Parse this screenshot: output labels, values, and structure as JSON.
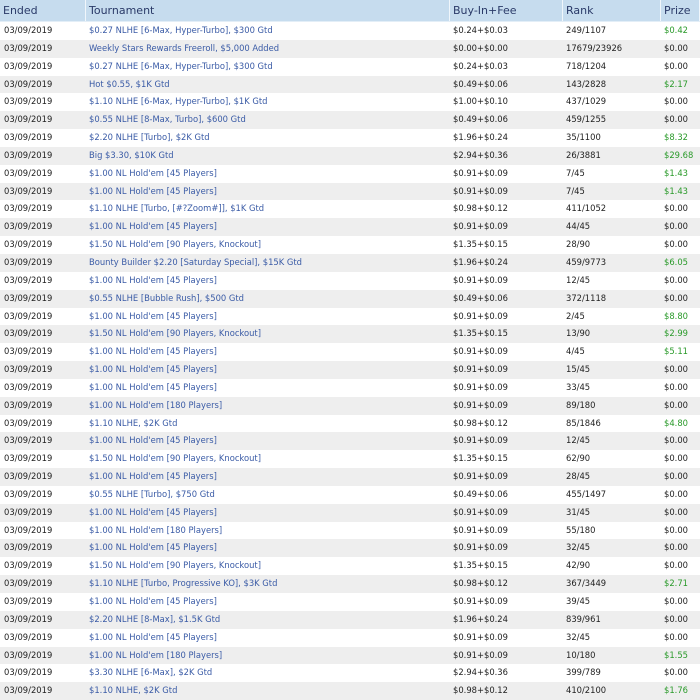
{
  "headers": {
    "ended": "Ended",
    "tournament": "Tournament",
    "buyin": "Buy-In+Fee",
    "rank": "Rank",
    "prize": "Prize"
  },
  "rows": [
    {
      "ended": "03/09/2019",
      "tournament": "$0.27 NLHE [6-Max, Hyper-Turbo], $300 Gtd",
      "buyin": "$0.24+$0.03",
      "rank": "249/1107",
      "prize": "$0.42"
    },
    {
      "ended": "03/09/2019",
      "tournament": "Weekly Stars Rewards Freeroll, $5,000 Added",
      "buyin": "$0.00+$0.00",
      "rank": "17679/23926",
      "prize": "$0.00"
    },
    {
      "ended": "03/09/2019",
      "tournament": "$0.27 NLHE [6-Max, Hyper-Turbo], $300 Gtd",
      "buyin": "$0.24+$0.03",
      "rank": "718/1204",
      "prize": "$0.00"
    },
    {
      "ended": "03/09/2019",
      "tournament": "Hot $0.55, $1K Gtd",
      "buyin": "$0.49+$0.06",
      "rank": "143/2828",
      "prize": "$2.17"
    },
    {
      "ended": "03/09/2019",
      "tournament": "$1.10 NLHE [6-Max, Hyper-Turbo], $1K Gtd",
      "buyin": "$1.00+$0.10",
      "rank": "437/1029",
      "prize": "$0.00"
    },
    {
      "ended": "03/09/2019",
      "tournament": "$0.55 NLHE [8-Max, Turbo], $600 Gtd",
      "buyin": "$0.49+$0.06",
      "rank": "459/1255",
      "prize": "$0.00"
    },
    {
      "ended": "03/09/2019",
      "tournament": "$2.20 NLHE [Turbo], $2K Gtd",
      "buyin": "$1.96+$0.24",
      "rank": "35/1100",
      "prize": "$8.32"
    },
    {
      "ended": "03/09/2019",
      "tournament": "Big $3.30, $10K Gtd",
      "buyin": "$2.94+$0.36",
      "rank": "26/3881",
      "prize": "$29.68"
    },
    {
      "ended": "03/09/2019",
      "tournament": "$1.00 NL Hold'em [45 Players]",
      "buyin": "$0.91+$0.09",
      "rank": "7/45",
      "prize": "$1.43"
    },
    {
      "ended": "03/09/2019",
      "tournament": "$1.00 NL Hold'em [45 Players]",
      "buyin": "$0.91+$0.09",
      "rank": "7/45",
      "prize": "$1.43"
    },
    {
      "ended": "03/09/2019",
      "tournament": "$1.10 NLHE [Turbo, [#?Zoom#]], $1K Gtd",
      "buyin": "$0.98+$0.12",
      "rank": "411/1052",
      "prize": "$0.00"
    },
    {
      "ended": "03/09/2019",
      "tournament": "$1.00 NL Hold'em [45 Players]",
      "buyin": "$0.91+$0.09",
      "rank": "44/45",
      "prize": "$0.00"
    },
    {
      "ended": "03/09/2019",
      "tournament": "$1.50 NL Hold'em [90 Players, Knockout]",
      "buyin": "$1.35+$0.15",
      "rank": "28/90",
      "prize": "$0.00"
    },
    {
      "ended": "03/09/2019",
      "tournament": "Bounty Builder $2.20 [Saturday Special], $15K Gtd",
      "buyin": "$1.96+$0.24",
      "rank": "459/9773",
      "prize": "$6.05"
    },
    {
      "ended": "03/09/2019",
      "tournament": "$1.00 NL Hold'em [45 Players]",
      "buyin": "$0.91+$0.09",
      "rank": "12/45",
      "prize": "$0.00"
    },
    {
      "ended": "03/09/2019",
      "tournament": "$0.55 NLHE [Bubble Rush], $500 Gtd",
      "buyin": "$0.49+$0.06",
      "rank": "372/1118",
      "prize": "$0.00"
    },
    {
      "ended": "03/09/2019",
      "tournament": "$1.00 NL Hold'em [45 Players]",
      "buyin": "$0.91+$0.09",
      "rank": "2/45",
      "prize": "$8.80"
    },
    {
      "ended": "03/09/2019",
      "tournament": "$1.50 NL Hold'em [90 Players, Knockout]",
      "buyin": "$1.35+$0.15",
      "rank": "13/90",
      "prize": "$2.99"
    },
    {
      "ended": "03/09/2019",
      "tournament": "$1.00 NL Hold'em [45 Players]",
      "buyin": "$0.91+$0.09",
      "rank": "4/45",
      "prize": "$5.11"
    },
    {
      "ended": "03/09/2019",
      "tournament": "$1.00 NL Hold'em [45 Players]",
      "buyin": "$0.91+$0.09",
      "rank": "15/45",
      "prize": "$0.00"
    },
    {
      "ended": "03/09/2019",
      "tournament": "$1.00 NL Hold'em [45 Players]",
      "buyin": "$0.91+$0.09",
      "rank": "33/45",
      "prize": "$0.00"
    },
    {
      "ended": "03/09/2019",
      "tournament": "$1.00 NL Hold'em [180 Players]",
      "buyin": "$0.91+$0.09",
      "rank": "89/180",
      "prize": "$0.00"
    },
    {
      "ended": "03/09/2019",
      "tournament": "$1.10 NLHE, $2K Gtd",
      "buyin": "$0.98+$0.12",
      "rank": "85/1846",
      "prize": "$4.80"
    },
    {
      "ended": "03/09/2019",
      "tournament": "$1.00 NL Hold'em [45 Players]",
      "buyin": "$0.91+$0.09",
      "rank": "12/45",
      "prize": "$0.00"
    },
    {
      "ended": "03/09/2019",
      "tournament": "$1.50 NL Hold'em [90 Players, Knockout]",
      "buyin": "$1.35+$0.15",
      "rank": "62/90",
      "prize": "$0.00"
    },
    {
      "ended": "03/09/2019",
      "tournament": "$1.00 NL Hold'em [45 Players]",
      "buyin": "$0.91+$0.09",
      "rank": "28/45",
      "prize": "$0.00"
    },
    {
      "ended": "03/09/2019",
      "tournament": "$0.55 NLHE [Turbo], $750 Gtd",
      "buyin": "$0.49+$0.06",
      "rank": "455/1497",
      "prize": "$0.00"
    },
    {
      "ended": "03/09/2019",
      "tournament": "$1.00 NL Hold'em [45 Players]",
      "buyin": "$0.91+$0.09",
      "rank": "31/45",
      "prize": "$0.00"
    },
    {
      "ended": "03/09/2019",
      "tournament": "$1.00 NL Hold'em [180 Players]",
      "buyin": "$0.91+$0.09",
      "rank": "55/180",
      "prize": "$0.00"
    },
    {
      "ended": "03/09/2019",
      "tournament": "$1.00 NL Hold'em [45 Players]",
      "buyin": "$0.91+$0.09",
      "rank": "32/45",
      "prize": "$0.00"
    },
    {
      "ended": "03/09/2019",
      "tournament": "$1.50 NL Hold'em [90 Players, Knockout]",
      "buyin": "$1.35+$0.15",
      "rank": "42/90",
      "prize": "$0.00"
    },
    {
      "ended": "03/09/2019",
      "tournament": "$1.10 NLHE [Turbo, Progressive KO], $3K Gtd",
      "buyin": "$0.98+$0.12",
      "rank": "367/3449",
      "prize": "$2.71"
    },
    {
      "ended": "03/09/2019",
      "tournament": "$1.00 NL Hold'em [45 Players]",
      "buyin": "$0.91+$0.09",
      "rank": "39/45",
      "prize": "$0.00"
    },
    {
      "ended": "03/09/2019",
      "tournament": "$2.20 NLHE [8-Max], $1.5K Gtd",
      "buyin": "$1.96+$0.24",
      "rank": "839/961",
      "prize": "$0.00"
    },
    {
      "ended": "03/09/2019",
      "tournament": "$1.00 NL Hold'em [45 Players]",
      "buyin": "$0.91+$0.09",
      "rank": "32/45",
      "prize": "$0.00"
    },
    {
      "ended": "03/09/2019",
      "tournament": "$1.00 NL Hold'em [180 Players]",
      "buyin": "$0.91+$0.09",
      "rank": "10/180",
      "prize": "$1.55"
    },
    {
      "ended": "03/09/2019",
      "tournament": "$3.30 NLHE [6-Max], $2K Gtd",
      "buyin": "$2.94+$0.36",
      "rank": "399/789",
      "prize": "$0.00"
    },
    {
      "ended": "03/09/2019",
      "tournament": "$1.10 NLHE, $2K Gtd",
      "buyin": "$0.98+$0.12",
      "rank": "410/2100",
      "prize": "$1.76"
    }
  ]
}
